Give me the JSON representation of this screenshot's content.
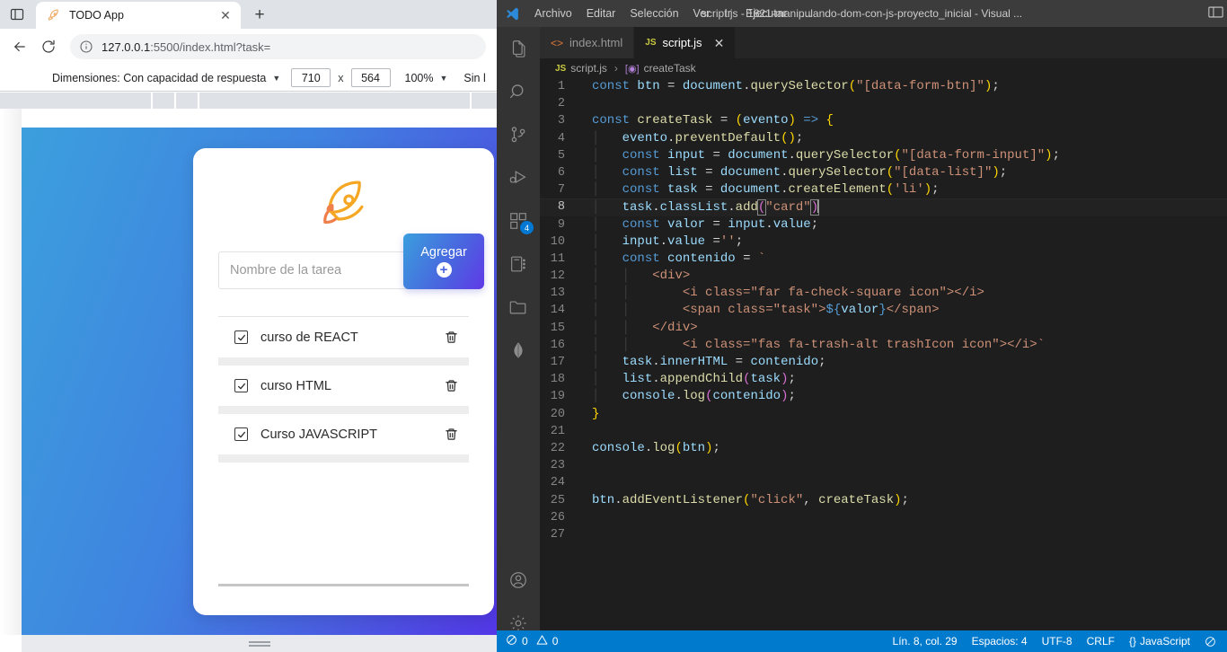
{
  "browser": {
    "tab": {
      "title": "TODO App",
      "favicon": "rocket-icon",
      "close": "✕"
    },
    "newtab_label": "+",
    "nav": {
      "back": "←",
      "reload": "⟳",
      "info": "ⓘ"
    },
    "url": {
      "host": "127.0.0.1",
      "rest": ":5500/index.html?task="
    },
    "devtools": {
      "dimensions_label": "Dimensiones: Con capacidad de respuesta",
      "caret": "▼",
      "width": "710",
      "height": "564",
      "x_label": "x",
      "zoom": "100%",
      "zoom_caret": "▼",
      "throttle": "Sin l"
    }
  },
  "app": {
    "input_placeholder": "Nombre de la tarea",
    "add_button_label": "Agregar",
    "add_button_icon": "plus-circle-icon",
    "tasks": [
      {
        "label": "curso de REACT",
        "checked": true
      },
      {
        "label": "curso HTML",
        "checked": true
      },
      {
        "label": "Curso JAVASCRIPT",
        "checked": true
      }
    ]
  },
  "vscode": {
    "menu": [
      "Archivo",
      "Editar",
      "Selección",
      "Ver",
      "Ir",
      "Ejecutar",
      "…"
    ],
    "window_title": "script.js - 1821-manipulando-dom-con-js-proyecto_inicial - Visual ...",
    "tabs": [
      {
        "label": "index.html",
        "icon": "html-tag-icon",
        "active": false,
        "close": ""
      },
      {
        "label": "script.js",
        "icon": "js-icon",
        "active": true,
        "close": "✕"
      }
    ],
    "breadcrumb": {
      "file": "script.js",
      "sep": "›",
      "symbol": "createTask",
      "symbol_icon": "method-icon"
    },
    "activity_bar": [
      {
        "name": "explorer-icon"
      },
      {
        "name": "search-icon"
      },
      {
        "name": "source-control-icon"
      },
      {
        "name": "run-debug-icon"
      },
      {
        "name": "extensions-icon",
        "badge": "4"
      },
      {
        "name": "remote-notebook-icon"
      },
      {
        "name": "folder-icon"
      },
      {
        "name": "mongodb-leaf-icon"
      },
      {
        "name": "account-icon"
      },
      {
        "name": "settings-gear-icon"
      }
    ],
    "status_bar": {
      "errors_icon": "error-icon",
      "errors": "0",
      "warnings_icon": "warning-icon",
      "warnings": "0",
      "position": "Lín. 8, col. 29",
      "spaces": "Espacios: 4",
      "encoding": "UTF-8",
      "eol": "CRLF",
      "language": "JavaScript",
      "language_icon": "{}",
      "bell_icon": "⃠"
    },
    "code": {
      "language": "javascript",
      "cursor_line": 8,
      "lines": [
        {
          "n": 1,
          "text": "const btn = document.querySelector(\"[data-form-btn]\");"
        },
        {
          "n": 2,
          "text": ""
        },
        {
          "n": 3,
          "text": "const createTask = (evento) => {"
        },
        {
          "n": 4,
          "text": "    evento.preventDefault();"
        },
        {
          "n": 5,
          "text": "    const input = document.querySelector(\"[data-form-input]\");"
        },
        {
          "n": 6,
          "text": "    const list = document.querySelector(\"[data-list]\");"
        },
        {
          "n": 7,
          "text": "    const task = document.createElement('li');"
        },
        {
          "n": 8,
          "text": "    task.classList.add(\"card\")"
        },
        {
          "n": 9,
          "text": "    const valor = input.value;"
        },
        {
          "n": 10,
          "text": "    input.value ='';"
        },
        {
          "n": 11,
          "text": "    const contenido = `"
        },
        {
          "n": 12,
          "text": "        <div>"
        },
        {
          "n": 13,
          "text": "            <i class=\"far fa-check-square icon\"></i>"
        },
        {
          "n": 14,
          "text": "            <span class=\"task\">${valor}</span>"
        },
        {
          "n": 15,
          "text": "        </div>"
        },
        {
          "n": 16,
          "text": "            <i class=\"fas fa-trash-alt trashIcon icon\"></i>`"
        },
        {
          "n": 17,
          "text": "    task.innerHTML = contenido;"
        },
        {
          "n": 18,
          "text": "    list.appendChild(task);"
        },
        {
          "n": 19,
          "text": "    console.log(contenido);"
        },
        {
          "n": 20,
          "text": "}"
        },
        {
          "n": 21,
          "text": ""
        },
        {
          "n": 22,
          "text": "console.log(btn);"
        },
        {
          "n": 23,
          "text": ""
        },
        {
          "n": 24,
          "text": ""
        },
        {
          "n": 25,
          "text": "btn.addEventListener(\"click\", createTask);"
        },
        {
          "n": 26,
          "text": ""
        },
        {
          "n": 27,
          "text": ""
        }
      ]
    }
  },
  "colors": {
    "vscode_accent": "#007acc",
    "vscode_titlebar": "#3c3c3c",
    "vscode_editor_bg": "#1e1e1e",
    "app_gradient_start": "#3c9fdd",
    "app_gradient_end": "#5237e6",
    "rocket_orange": "#f5a623"
  }
}
